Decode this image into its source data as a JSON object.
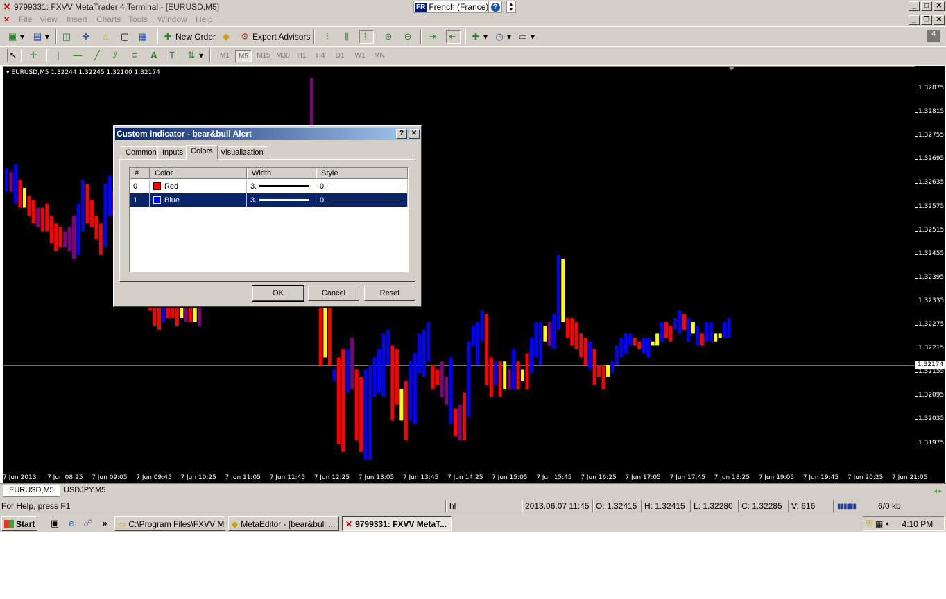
{
  "window": {
    "title": "9799331: FXVV MetaTrader 4 Terminal - [EURUSD,M5]",
    "language": {
      "flag": "FR",
      "name": "French (France)"
    }
  },
  "menu": [
    "File",
    "View",
    "Insert",
    "Charts",
    "Tools",
    "Window",
    "Help"
  ],
  "toolbar": {
    "new_order": "New Order",
    "expert_advisors": "Expert Advisors",
    "notifications_count": "4"
  },
  "timeframes": [
    "M1",
    "M5",
    "M15",
    "M30",
    "H1",
    "H4",
    "D1",
    "W1",
    "MN"
  ],
  "active_timeframe": "M5",
  "chart": {
    "info": "EURUSD,M5  1.32244 1.32245 1.32100 1.32174",
    "current_price": "1.32174",
    "price_labels": [
      "1.32875",
      "1.32815",
      "1.32755",
      "1.32695",
      "1.32635",
      "1.32575",
      "1.32515",
      "1.32455",
      "1.32395",
      "1.32335",
      "1.32275",
      "1.32215",
      "1.32155",
      "1.32095",
      "1.32035",
      "1.31975"
    ],
    "time_labels": [
      "7 Jun 2013",
      "7 Jun 08:25",
      "7 Jun 09:05",
      "7 Jun 09:45",
      "7 Jun 10:25",
      "7 Jun 11:05",
      "7 Jun 11:45",
      "7 Jun 12:25",
      "7 Jun 13:05",
      "7 Jun 13:45",
      "7 Jun 14:25",
      "7 Jun 15:05",
      "7 Jun 15:45",
      "7 Jun 16:25",
      "7 Jun 17:05",
      "7 Jun 17:45",
      "7 Jun 18:25",
      "7 Jun 19:05",
      "7 Jun 19:45",
      "7 Jun 20:25",
      "7 Jun 21:05"
    ],
    "colors": {
      "background": "#000000",
      "red": "#ff0000",
      "blue": "#0000ff",
      "yellow": "#ffff00",
      "purple": "#800080"
    }
  },
  "chart_data": {
    "type": "bar",
    "title": "EURUSD,M5",
    "ylim": [
      1.3192,
      1.3293
    ],
    "series": [
      {
        "name": "Red",
        "color": "#ff0000"
      },
      {
        "name": "Blue",
        "color": "#0000ff"
      }
    ],
    "bars": [
      [
        "b",
        1.32675,
        1.32615
      ],
      [
        "p",
        1.32665,
        1.32615
      ],
      [
        "b",
        1.32685,
        1.32585
      ],
      [
        "r",
        1.32645,
        1.32575
      ],
      [
        "y",
        1.32625,
        1.32575
      ],
      [
        "r",
        1.32605,
        1.32555
      ],
      [
        "r",
        1.32595,
        1.32535
      ],
      [
        "p",
        1.32575,
        1.32525
      ],
      [
        "r",
        1.32575,
        1.32515
      ],
      [
        "r",
        1.32585,
        1.32515
      ],
      [
        "r",
        1.32555,
        1.32485
      ],
      [
        "r",
        1.32535,
        1.32465
      ],
      [
        "r",
        1.32525,
        1.32475
      ],
      [
        "p",
        1.32515,
        1.32475
      ],
      [
        "p",
        1.32525,
        1.32465
      ],
      [
        "p",
        1.32555,
        1.32445
      ],
      [
        "b",
        1.32585,
        1.32455
      ],
      [
        "b",
        1.32645,
        1.32515
      ],
      [
        "r",
        1.32635,
        1.32535
      ],
      [
        "r",
        1.32595,
        1.32525
      ],
      [
        "r",
        1.32555,
        1.32495
      ],
      [
        "r",
        1.32535,
        1.32455
      ],
      [
        "b",
        1.32635,
        1.32475
      ],
      [
        "b",
        1.32655,
        1.32555
      ],
      [
        "p",
        1.32615,
        1.32555
      ],
      [
        "p",
        1.32565,
        1.32485
      ],
      [
        "b",
        1.32585,
        1.32495
      ],
      [
        "b",
        1.32595,
        1.32505
      ],
      [
        "b",
        1.32605,
        1.32515
      ],
      [
        "p",
        1.32575,
        1.32505
      ],
      [
        "b",
        1.32605,
        1.32505
      ],
      [
        "b",
        1.32575,
        1.32475
      ],
      [
        "r",
        1.32335,
        1.32315
      ],
      [
        "r",
        1.32325,
        1.32275
      ],
      [
        "r",
        1.32325,
        1.32265
      ],
      [
        "b",
        1.32335,
        1.32285
      ],
      [
        "r",
        1.32325,
        1.32295
      ],
      [
        "r",
        1.32325,
        1.32295
      ],
      [
        "r",
        1.32335,
        1.32275
      ],
      [
        "y",
        1.32325,
        1.32295
      ],
      [
        "p",
        1.32325,
        1.32285
      ],
      [
        "r",
        1.32325,
        1.32285
      ],
      [
        "y",
        1.32325,
        1.32285
      ],
      [
        "p",
        1.32335,
        1.32275
      ],
      [
        "b",
        1.32665,
        1.32545
      ],
      [
        "b",
        1.32655,
        1.32535
      ],
      [
        "r",
        1.32635,
        1.32525
      ],
      [
        "p",
        1.32595,
        1.32495
      ],
      [
        "b",
        1.32565,
        1.32505
      ],
      [
        "b",
        1.32565,
        1.32525
      ],
      [
        "b",
        1.32715,
        1.32575
      ],
      [
        "y",
        1.32695,
        1.32645
      ],
      [
        "p",
        1.32665,
        1.32575
      ],
      [
        "b",
        1.32655,
        1.32585
      ],
      [
        "r",
        1.32635,
        1.32495
      ],
      [
        "r",
        1.32615,
        1.32495
      ],
      [
        "b",
        1.32635,
        1.32525
      ],
      [
        "b",
        1.32635,
        1.32545
      ],
      [
        "y",
        1.32615,
        1.32555
      ],
      [
        "b",
        1.32615,
        1.32575
      ],
      [
        "b",
        1.32595,
        1.32535
      ],
      [
        "p",
        1.32625,
        1.32525
      ],
      [
        "p",
        1.32635,
        1.32495
      ],
      [
        "b",
        1.32675,
        1.32555
      ],
      [
        "b",
        1.32695,
        1.32535
      ],
      [
        "p",
        1.32695,
        1.32525
      ],
      [
        "p",
        1.32695,
        1.32525
      ],
      [
        "r",
        1.32695,
        1.32535
      ],
      [
        "p",
        1.32905,
        1.32335
      ],
      [
        "y",
        1.32775,
        1.32375
      ],
      [
        "r",
        1.32485,
        1.32175
      ],
      [
        "y",
        1.32405,
        1.32195
      ],
      [
        "r",
        1.32345,
        1.32175
      ],
      [
        "b",
        1.32165,
        1.32135
      ],
      [
        "r",
        1.32195,
        1.31975
      ],
      [
        "r",
        1.32215,
        1.31955
      ],
      [
        "b",
        1.32215,
        1.32105
      ],
      [
        "p",
        1.32245,
        1.32115
      ],
      [
        "r",
        1.32165,
        1.31985
      ],
      [
        "r",
        1.32145,
        1.31955
      ],
      [
        "b",
        1.32165,
        1.31935
      ],
      [
        "b",
        1.32175,
        1.31935
      ],
      [
        "b",
        1.32195,
        1.32095
      ],
      [
        "b",
        1.32215,
        1.32105
      ],
      [
        "b",
        1.32255,
        1.32095
      ],
      [
        "b",
        1.32265,
        1.32175
      ],
      [
        "r",
        1.32225,
        1.32035
      ],
      [
        "r",
        1.32215,
        1.32075
      ],
      [
        "y",
        1.32115,
        1.32035
      ],
      [
        "r",
        1.32135,
        1.31985
      ],
      [
        "b",
        1.32185,
        1.32035
      ],
      [
        "b",
        1.32205,
        1.32025
      ],
      [
        "b",
        1.32255,
        1.32155
      ],
      [
        "b",
        1.32265,
        1.32145
      ],
      [
        "b",
        1.32285,
        1.32185
      ],
      [
        "r",
        1.32175,
        1.32115
      ],
      [
        "r",
        1.32165,
        1.32125
      ],
      [
        "p",
        1.32185,
        1.32095
      ],
      [
        "p",
        1.32145,
        1.32075
      ],
      [
        "b",
        1.32195,
        1.32025
      ],
      [
        "r",
        1.32065,
        1.31995
      ],
      [
        "p",
        1.32075,
        1.31985
      ],
      [
        "r",
        1.32105,
        1.31985
      ],
      [
        "b",
        1.32235,
        1.32045
      ],
      [
        "b",
        1.32275,
        1.32225
      ],
      [
        "b",
        1.32285,
        1.32175
      ],
      [
        "b",
        1.32315,
        1.32235
      ],
      [
        "r",
        1.32305,
        1.32125
      ],
      [
        "r",
        1.32195,
        1.32095
      ],
      [
        "b",
        1.32185,
        1.32125
      ],
      [
        "r",
        1.32185,
        1.32095
      ],
      [
        "y",
        1.32185,
        1.32115
      ],
      [
        "p",
        1.32165,
        1.32115
      ],
      [
        "b",
        1.32215,
        1.32115
      ],
      [
        "r",
        1.32185,
        1.32115
      ],
      [
        "y",
        1.32165,
        1.32135
      ],
      [
        "r",
        1.32205,
        1.32115
      ],
      [
        "b",
        1.32245,
        1.32155
      ],
      [
        "b",
        1.32285,
        1.32195
      ],
      [
        "b",
        1.32285,
        1.32175
      ],
      [
        "y",
        1.32275,
        1.32235
      ],
      [
        "p",
        1.32285,
        1.32225
      ],
      [
        "b",
        1.32305,
        1.32215
      ],
      [
        "b",
        1.32455,
        1.32265
      ],
      [
        "y",
        1.32445,
        1.32285
      ],
      [
        "r",
        1.32295,
        1.32245
      ],
      [
        "r",
        1.32295,
        1.32225
      ],
      [
        "r",
        1.32285,
        1.32215
      ],
      [
        "r",
        1.32255,
        1.32195
      ],
      [
        "r",
        1.32245,
        1.32175
      ],
      [
        "b",
        1.32235,
        1.32165
      ],
      [
        "r",
        1.32215,
        1.32125
      ],
      [
        "r",
        1.32175,
        1.32145
      ],
      [
        "r",
        1.32175,
        1.32115
      ],
      [
        "y",
        1.32175,
        1.32145
      ],
      [
        "b",
        1.32185,
        1.32155
      ],
      [
        "b",
        1.32225,
        1.32175
      ],
      [
        "b",
        1.32245,
        1.32195
      ],
      [
        "b",
        1.32255,
        1.32205
      ],
      [
        "b",
        1.32255,
        1.32225
      ],
      [
        "r",
        1.32245,
        1.32225
      ],
      [
        "r",
        1.32235,
        1.32215
      ],
      [
        "b",
        1.32245,
        1.32205
      ],
      [
        "b",
        1.32245,
        1.32195
      ],
      [
        "y",
        1.32235,
        1.32225
      ],
      [
        "y",
        1.32255,
        1.32225
      ],
      [
        "b",
        1.32285,
        1.32235
      ],
      [
        "r",
        1.32285,
        1.32245
      ],
      [
        "r",
        1.32275,
        1.32235
      ],
      [
        "b",
        1.32295,
        1.32265
      ],
      [
        "b",
        1.32315,
        1.32255
      ],
      [
        "r",
        1.32305,
        1.32265
      ],
      [
        "b",
        1.32295,
        1.32235
      ],
      [
        "y",
        1.32285,
        1.32255
      ],
      [
        "b",
        1.32275,
        1.32225
      ],
      [
        "r",
        1.32255,
        1.32225
      ],
      [
        "b",
        1.32285,
        1.32235
      ],
      [
        "b",
        1.32285,
        1.32235
      ],
      [
        "y",
        1.32255,
        1.32235
      ],
      [
        "y",
        1.32255,
        1.32245
      ],
      [
        "b",
        1.32285,
        1.32245
      ],
      [
        "b",
        1.32295,
        1.32245
      ]
    ]
  },
  "chart_tabs": [
    "EURUSD,M5",
    "USDJPY,M5"
  ],
  "status": {
    "help": "For Help, press F1",
    "profile": "hl",
    "datetime": "2013.06.07 11:45",
    "open": "O: 1.32415",
    "high": "H: 1.32415",
    "low": "L: 1.32280",
    "close": "C: 1.32285",
    "volume": "V: 616",
    "traffic": "6/0 kb"
  },
  "taskbar": {
    "start": "Start",
    "more": "»",
    "tasks": [
      "C:\\Program Files\\FXVV M...",
      "MetaEditor - [bear&bull ...",
      "9799331: FXVV MetaT..."
    ],
    "clock": "4:10 PM"
  },
  "dialog": {
    "title": "Custom Indicator - bear&bull  Alert",
    "tabs": [
      "Common",
      "Inputs",
      "Colors",
      "Visualization"
    ],
    "active_tab": "Colors",
    "columns": [
      "#",
      "Color",
      "Width",
      "Style"
    ],
    "rows": [
      {
        "index": "0",
        "color_name": "Red",
        "color": "#ff0000",
        "width": "3.",
        "style": "0."
      },
      {
        "index": "1",
        "color_name": "Blue",
        "color": "#0000ff",
        "width": "3.",
        "style": "0."
      }
    ],
    "buttons": {
      "ok": "OK",
      "cancel": "Cancel",
      "reset": "Reset"
    }
  }
}
